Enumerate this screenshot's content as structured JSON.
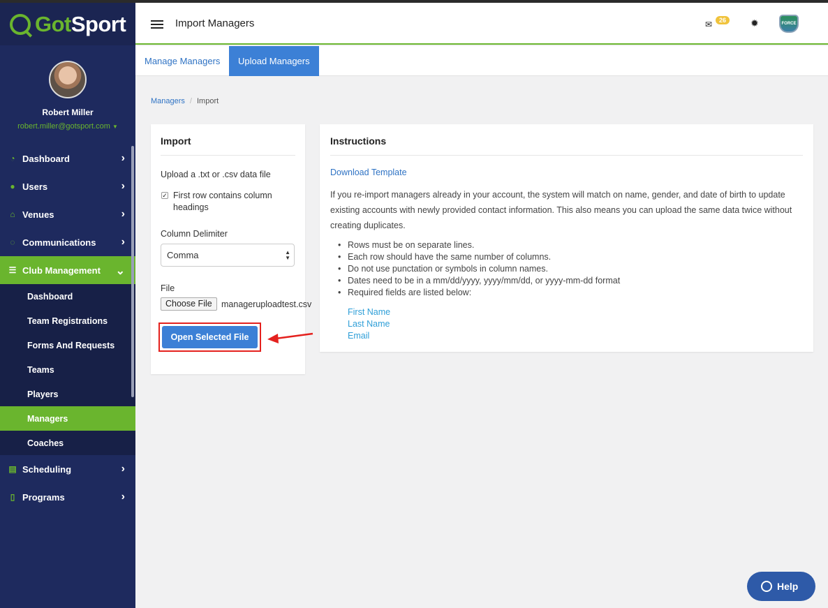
{
  "brand": {
    "logo_part1": "Got",
    "logo_part2": "Sport"
  },
  "profile": {
    "name": "Robert Miller",
    "email": "robert.miller@gotsport.com"
  },
  "sidebar": {
    "items": [
      {
        "label": "Dashboard"
      },
      {
        "label": "Users"
      },
      {
        "label": "Venues"
      },
      {
        "label": "Communications"
      },
      {
        "label": "Club Management"
      }
    ],
    "club_sub": [
      {
        "label": "Dashboard"
      },
      {
        "label": "Team Registrations"
      },
      {
        "label": "Forms And Requests"
      },
      {
        "label": "Teams"
      },
      {
        "label": "Players"
      },
      {
        "label": "Managers"
      },
      {
        "label": "Coaches"
      }
    ],
    "bottom_items": [
      {
        "label": "Scheduling"
      },
      {
        "label": "Programs"
      }
    ]
  },
  "header": {
    "title": "Import Managers",
    "mail_count": "26",
    "crest_text": "FORCE"
  },
  "tabs": [
    {
      "label": "Manage Managers"
    },
    {
      "label": "Upload Managers"
    }
  ],
  "breadcrumb": {
    "link": "Managers",
    "separator": "/",
    "current": "Import"
  },
  "import": {
    "title": "Import",
    "upload_label": "Upload a .txt or .csv data file",
    "checkbox_label": "First row contains column headings",
    "delimiter_label": "Column Delimiter",
    "delimiter_value": "Comma",
    "file_label": "File",
    "choose_button": "Choose File",
    "file_name": "manageruploadtest.csv",
    "open_button": "Open Selected File"
  },
  "instructions": {
    "title": "Instructions",
    "download_link": "Download Template",
    "paragraph": "If you re-import managers already in your account, the system will match on name, gender, and date of birth to update existing accounts with newly provided contact information. This also means you can upload the same data twice without creating duplicates.",
    "rules": [
      "Rows must be on separate lines.",
      "Each row should have the same number of columns.",
      "Do not use punctation or symbols in column names.",
      "Dates need to be in a mm/dd/yyyy, yyyy/mm/dd, or yyyy-mm-dd format",
      "Required fields are listed below:"
    ],
    "required_fields": [
      "First Name",
      "Last Name",
      "Email"
    ]
  },
  "help": {
    "label": "Help"
  },
  "colors": {
    "accent_green": "#6ab52e",
    "sidebar_navy": "#1e2a5e",
    "primary_blue": "#3c80d6",
    "highlight_red": "#e4211e"
  },
  "icons": [
    "dashboard-icon",
    "users-icon",
    "venues-icon",
    "communications-icon",
    "club-management-icon",
    "scheduling-icon",
    "programs-icon",
    "envelope-icon",
    "gear-icon",
    "chevron-right-icon",
    "chevron-down-icon",
    "chat-bubble-icon"
  ]
}
